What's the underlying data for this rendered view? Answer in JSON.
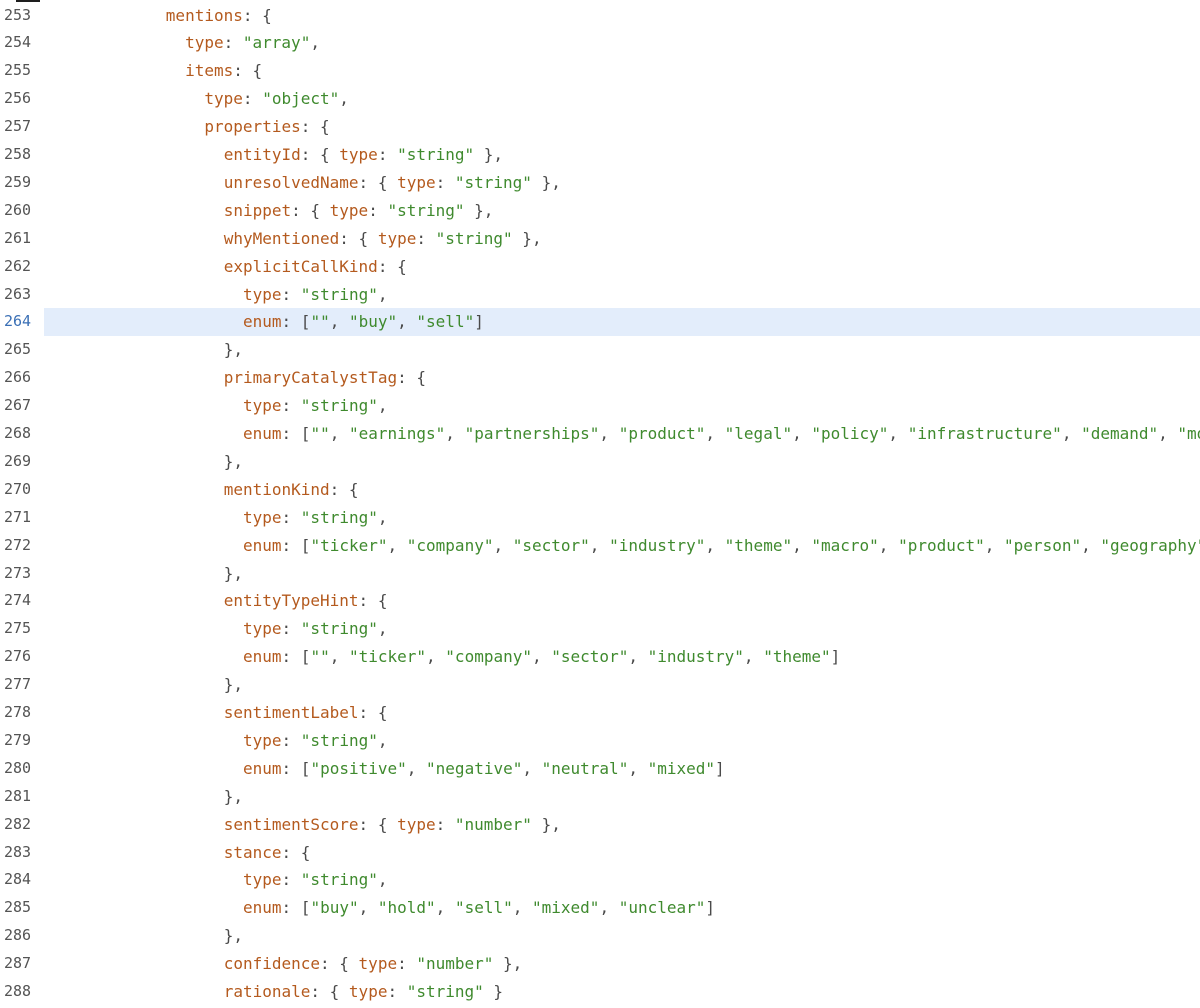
{
  "editor": {
    "active_line": 264,
    "colors": {
      "key": "#b45a1e",
      "string": "#3f8a2e",
      "punctuation": "#4a4a4a",
      "active_line_bg": "#e3edfb",
      "active_line_number": "#3a6fb5"
    },
    "lines": [
      {
        "n": "253",
        "indent": 6,
        "tokens": [
          [
            "k",
            "mentions"
          ],
          [
            "p",
            ": {"
          ]
        ]
      },
      {
        "n": "254",
        "indent": 7,
        "tokens": [
          [
            "k",
            "type"
          ],
          [
            "p",
            ": "
          ],
          [
            "s",
            "\"array\""
          ],
          [
            "p",
            ","
          ]
        ]
      },
      {
        "n": "255",
        "indent": 7,
        "tokens": [
          [
            "k",
            "items"
          ],
          [
            "p",
            ": {"
          ]
        ]
      },
      {
        "n": "256",
        "indent": 8,
        "tokens": [
          [
            "k",
            "type"
          ],
          [
            "p",
            ": "
          ],
          [
            "s",
            "\"object\""
          ],
          [
            "p",
            ","
          ]
        ]
      },
      {
        "n": "257",
        "indent": 8,
        "tokens": [
          [
            "k",
            "properties"
          ],
          [
            "p",
            ": {"
          ]
        ]
      },
      {
        "n": "258",
        "indent": 9,
        "tokens": [
          [
            "k",
            "entityId"
          ],
          [
            "p",
            ": { "
          ],
          [
            "k",
            "type"
          ],
          [
            "p",
            ": "
          ],
          [
            "s",
            "\"string\""
          ],
          [
            "p",
            " },"
          ]
        ]
      },
      {
        "n": "259",
        "indent": 9,
        "tokens": [
          [
            "k",
            "unresolvedName"
          ],
          [
            "p",
            ": { "
          ],
          [
            "k",
            "type"
          ],
          [
            "p",
            ": "
          ],
          [
            "s",
            "\"string\""
          ],
          [
            "p",
            " },"
          ]
        ]
      },
      {
        "n": "260",
        "indent": 9,
        "tokens": [
          [
            "k",
            "snippet"
          ],
          [
            "p",
            ": { "
          ],
          [
            "k",
            "type"
          ],
          [
            "p",
            ": "
          ],
          [
            "s",
            "\"string\""
          ],
          [
            "p",
            " },"
          ]
        ]
      },
      {
        "n": "261",
        "indent": 9,
        "tokens": [
          [
            "k",
            "whyMentioned"
          ],
          [
            "p",
            ": { "
          ],
          [
            "k",
            "type"
          ],
          [
            "p",
            ": "
          ],
          [
            "s",
            "\"string\""
          ],
          [
            "p",
            " },"
          ]
        ]
      },
      {
        "n": "262",
        "indent": 9,
        "tokens": [
          [
            "k",
            "explicitCallKind"
          ],
          [
            "p",
            ": {"
          ]
        ]
      },
      {
        "n": "263",
        "indent": 10,
        "tokens": [
          [
            "k",
            "type"
          ],
          [
            "p",
            ": "
          ],
          [
            "s",
            "\"string\""
          ],
          [
            "p",
            ","
          ]
        ]
      },
      {
        "n": "264",
        "indent": 10,
        "tokens": [
          [
            "k",
            "enum"
          ],
          [
            "p",
            ": ["
          ],
          [
            "s",
            "\"\""
          ],
          [
            "p",
            ", "
          ],
          [
            "s",
            "\"buy\""
          ],
          [
            "p",
            ", "
          ],
          [
            "s",
            "\"sell\""
          ],
          [
            "p",
            "]"
          ]
        ]
      },
      {
        "n": "265",
        "indent": 9,
        "tokens": [
          [
            "p",
            "},"
          ]
        ]
      },
      {
        "n": "266",
        "indent": 9,
        "tokens": [
          [
            "k",
            "primaryCatalystTag"
          ],
          [
            "p",
            ": {"
          ]
        ]
      },
      {
        "n": "267",
        "indent": 10,
        "tokens": [
          [
            "k",
            "type"
          ],
          [
            "p",
            ": "
          ],
          [
            "s",
            "\"string\""
          ],
          [
            "p",
            ","
          ]
        ]
      },
      {
        "n": "268",
        "indent": 10,
        "tokens": [
          [
            "k",
            "enum"
          ],
          [
            "p",
            ": ["
          ],
          [
            "s",
            "\"\""
          ],
          [
            "p",
            ", "
          ],
          [
            "s",
            "\"earnings\""
          ],
          [
            "p",
            ", "
          ],
          [
            "s",
            "\"partnerships\""
          ],
          [
            "p",
            ", "
          ],
          [
            "s",
            "\"product\""
          ],
          [
            "p",
            ", "
          ],
          [
            "s",
            "\"legal\""
          ],
          [
            "p",
            ", "
          ],
          [
            "s",
            "\"policy\""
          ],
          [
            "p",
            ", "
          ],
          [
            "s",
            "\"infrastructure\""
          ],
          [
            "p",
            ", "
          ],
          [
            "s",
            "\"demand\""
          ],
          [
            "p",
            ", "
          ],
          [
            "s",
            "\"monet"
          ]
        ]
      },
      {
        "n": "269",
        "indent": 9,
        "tokens": [
          [
            "p",
            "},"
          ]
        ]
      },
      {
        "n": "270",
        "indent": 9,
        "tokens": [
          [
            "k",
            "mentionKind"
          ],
          [
            "p",
            ": {"
          ]
        ]
      },
      {
        "n": "271",
        "indent": 10,
        "tokens": [
          [
            "k",
            "type"
          ],
          [
            "p",
            ": "
          ],
          [
            "s",
            "\"string\""
          ],
          [
            "p",
            ","
          ]
        ]
      },
      {
        "n": "272",
        "indent": 10,
        "tokens": [
          [
            "k",
            "enum"
          ],
          [
            "p",
            ": ["
          ],
          [
            "s",
            "\"ticker\""
          ],
          [
            "p",
            ", "
          ],
          [
            "s",
            "\"company\""
          ],
          [
            "p",
            ", "
          ],
          [
            "s",
            "\"sector\""
          ],
          [
            "p",
            ", "
          ],
          [
            "s",
            "\"industry\""
          ],
          [
            "p",
            ", "
          ],
          [
            "s",
            "\"theme\""
          ],
          [
            "p",
            ", "
          ],
          [
            "s",
            "\"macro\""
          ],
          [
            "p",
            ", "
          ],
          [
            "s",
            "\"product\""
          ],
          [
            "p",
            ", "
          ],
          [
            "s",
            "\"person\""
          ],
          [
            "p",
            ", "
          ],
          [
            "s",
            "\"geography\""
          ],
          [
            "p",
            ", "
          ],
          [
            "s",
            "\""
          ]
        ]
      },
      {
        "n": "273",
        "indent": 9,
        "tokens": [
          [
            "p",
            "},"
          ]
        ]
      },
      {
        "n": "274",
        "indent": 9,
        "tokens": [
          [
            "k",
            "entityTypeHint"
          ],
          [
            "p",
            ": {"
          ]
        ]
      },
      {
        "n": "275",
        "indent": 10,
        "tokens": [
          [
            "k",
            "type"
          ],
          [
            "p",
            ": "
          ],
          [
            "s",
            "\"string\""
          ],
          [
            "p",
            ","
          ]
        ]
      },
      {
        "n": "276",
        "indent": 10,
        "tokens": [
          [
            "k",
            "enum"
          ],
          [
            "p",
            ": ["
          ],
          [
            "s",
            "\"\""
          ],
          [
            "p",
            ", "
          ],
          [
            "s",
            "\"ticker\""
          ],
          [
            "p",
            ", "
          ],
          [
            "s",
            "\"company\""
          ],
          [
            "p",
            ", "
          ],
          [
            "s",
            "\"sector\""
          ],
          [
            "p",
            ", "
          ],
          [
            "s",
            "\"industry\""
          ],
          [
            "p",
            ", "
          ],
          [
            "s",
            "\"theme\""
          ],
          [
            "p",
            "]"
          ]
        ]
      },
      {
        "n": "277",
        "indent": 9,
        "tokens": [
          [
            "p",
            "},"
          ]
        ]
      },
      {
        "n": "278",
        "indent": 9,
        "tokens": [
          [
            "k",
            "sentimentLabel"
          ],
          [
            "p",
            ": {"
          ]
        ]
      },
      {
        "n": "279",
        "indent": 10,
        "tokens": [
          [
            "k",
            "type"
          ],
          [
            "p",
            ": "
          ],
          [
            "s",
            "\"string\""
          ],
          [
            "p",
            ","
          ]
        ]
      },
      {
        "n": "280",
        "indent": 10,
        "tokens": [
          [
            "k",
            "enum"
          ],
          [
            "p",
            ": ["
          ],
          [
            "s",
            "\"positive\""
          ],
          [
            "p",
            ", "
          ],
          [
            "s",
            "\"negative\""
          ],
          [
            "p",
            ", "
          ],
          [
            "s",
            "\"neutral\""
          ],
          [
            "p",
            ", "
          ],
          [
            "s",
            "\"mixed\""
          ],
          [
            "p",
            "]"
          ]
        ]
      },
      {
        "n": "281",
        "indent": 9,
        "tokens": [
          [
            "p",
            "},"
          ]
        ]
      },
      {
        "n": "282",
        "indent": 9,
        "tokens": [
          [
            "k",
            "sentimentScore"
          ],
          [
            "p",
            ": { "
          ],
          [
            "k",
            "type"
          ],
          [
            "p",
            ": "
          ],
          [
            "s",
            "\"number\""
          ],
          [
            "p",
            " },"
          ]
        ]
      },
      {
        "n": "283",
        "indent": 9,
        "tokens": [
          [
            "k",
            "stance"
          ],
          [
            "p",
            ": {"
          ]
        ]
      },
      {
        "n": "284",
        "indent": 10,
        "tokens": [
          [
            "k",
            "type"
          ],
          [
            "p",
            ": "
          ],
          [
            "s",
            "\"string\""
          ],
          [
            "p",
            ","
          ]
        ]
      },
      {
        "n": "285",
        "indent": 10,
        "tokens": [
          [
            "k",
            "enum"
          ],
          [
            "p",
            ": ["
          ],
          [
            "s",
            "\"buy\""
          ],
          [
            "p",
            ", "
          ],
          [
            "s",
            "\"hold\""
          ],
          [
            "p",
            ", "
          ],
          [
            "s",
            "\"sell\""
          ],
          [
            "p",
            ", "
          ],
          [
            "s",
            "\"mixed\""
          ],
          [
            "p",
            ", "
          ],
          [
            "s",
            "\"unclear\""
          ],
          [
            "p",
            "]"
          ]
        ]
      },
      {
        "n": "286",
        "indent": 9,
        "tokens": [
          [
            "p",
            "},"
          ]
        ]
      },
      {
        "n": "287",
        "indent": 9,
        "tokens": [
          [
            "k",
            "confidence"
          ],
          [
            "p",
            ": { "
          ],
          [
            "k",
            "type"
          ],
          [
            "p",
            ": "
          ],
          [
            "s",
            "\"number\""
          ],
          [
            "p",
            " },"
          ]
        ]
      },
      {
        "n": "288",
        "indent": 9,
        "tokens": [
          [
            "k",
            "rationale"
          ],
          [
            "p",
            ": { "
          ],
          [
            "k",
            "type"
          ],
          [
            "p",
            ": "
          ],
          [
            "s",
            "\"string\""
          ],
          [
            "p",
            " }"
          ]
        ]
      }
    ]
  }
}
